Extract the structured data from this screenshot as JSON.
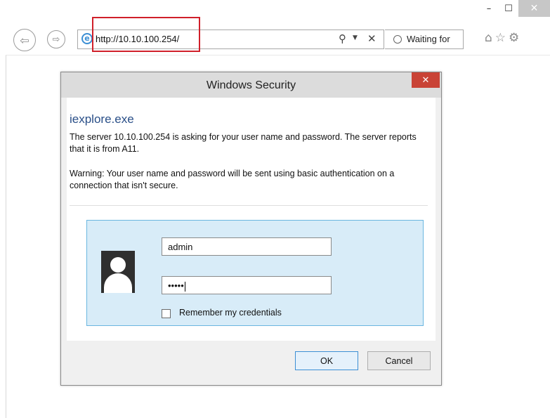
{
  "browser": {
    "window_controls": {
      "minimize": "–",
      "maximize": "☐",
      "close": "✕"
    },
    "address_bar": {
      "url": "http://10.10.100.254/"
    },
    "tab": {
      "label": "Waiting for"
    },
    "icons": [
      "back-icon",
      "forward-icon",
      "ie-icon",
      "search-icon",
      "dropdown-icon",
      "stop-icon",
      "home-icon",
      "favorites-icon",
      "settings-icon"
    ]
  },
  "dialog": {
    "title": "Windows Security",
    "close_label": "✕",
    "app_name": "iexplore.exe",
    "message": "The server 10.10.100.254 is asking for your user name and password. The server reports that it is from A11.",
    "warning": "Warning: Your user name and password will be sent using basic authentication on a connection that isn't secure.",
    "username_value": "admin",
    "password_mask": "•••••",
    "remember_label": "Remember my credentials",
    "remember_checked": false,
    "ok_label": "OK",
    "cancel_label": "Cancel"
  },
  "colors": {
    "highlight_box": "#d0202a",
    "dialog_close": "#c94336",
    "app_name": "#2a4f88",
    "cred_panel": "#d8ecf8"
  }
}
